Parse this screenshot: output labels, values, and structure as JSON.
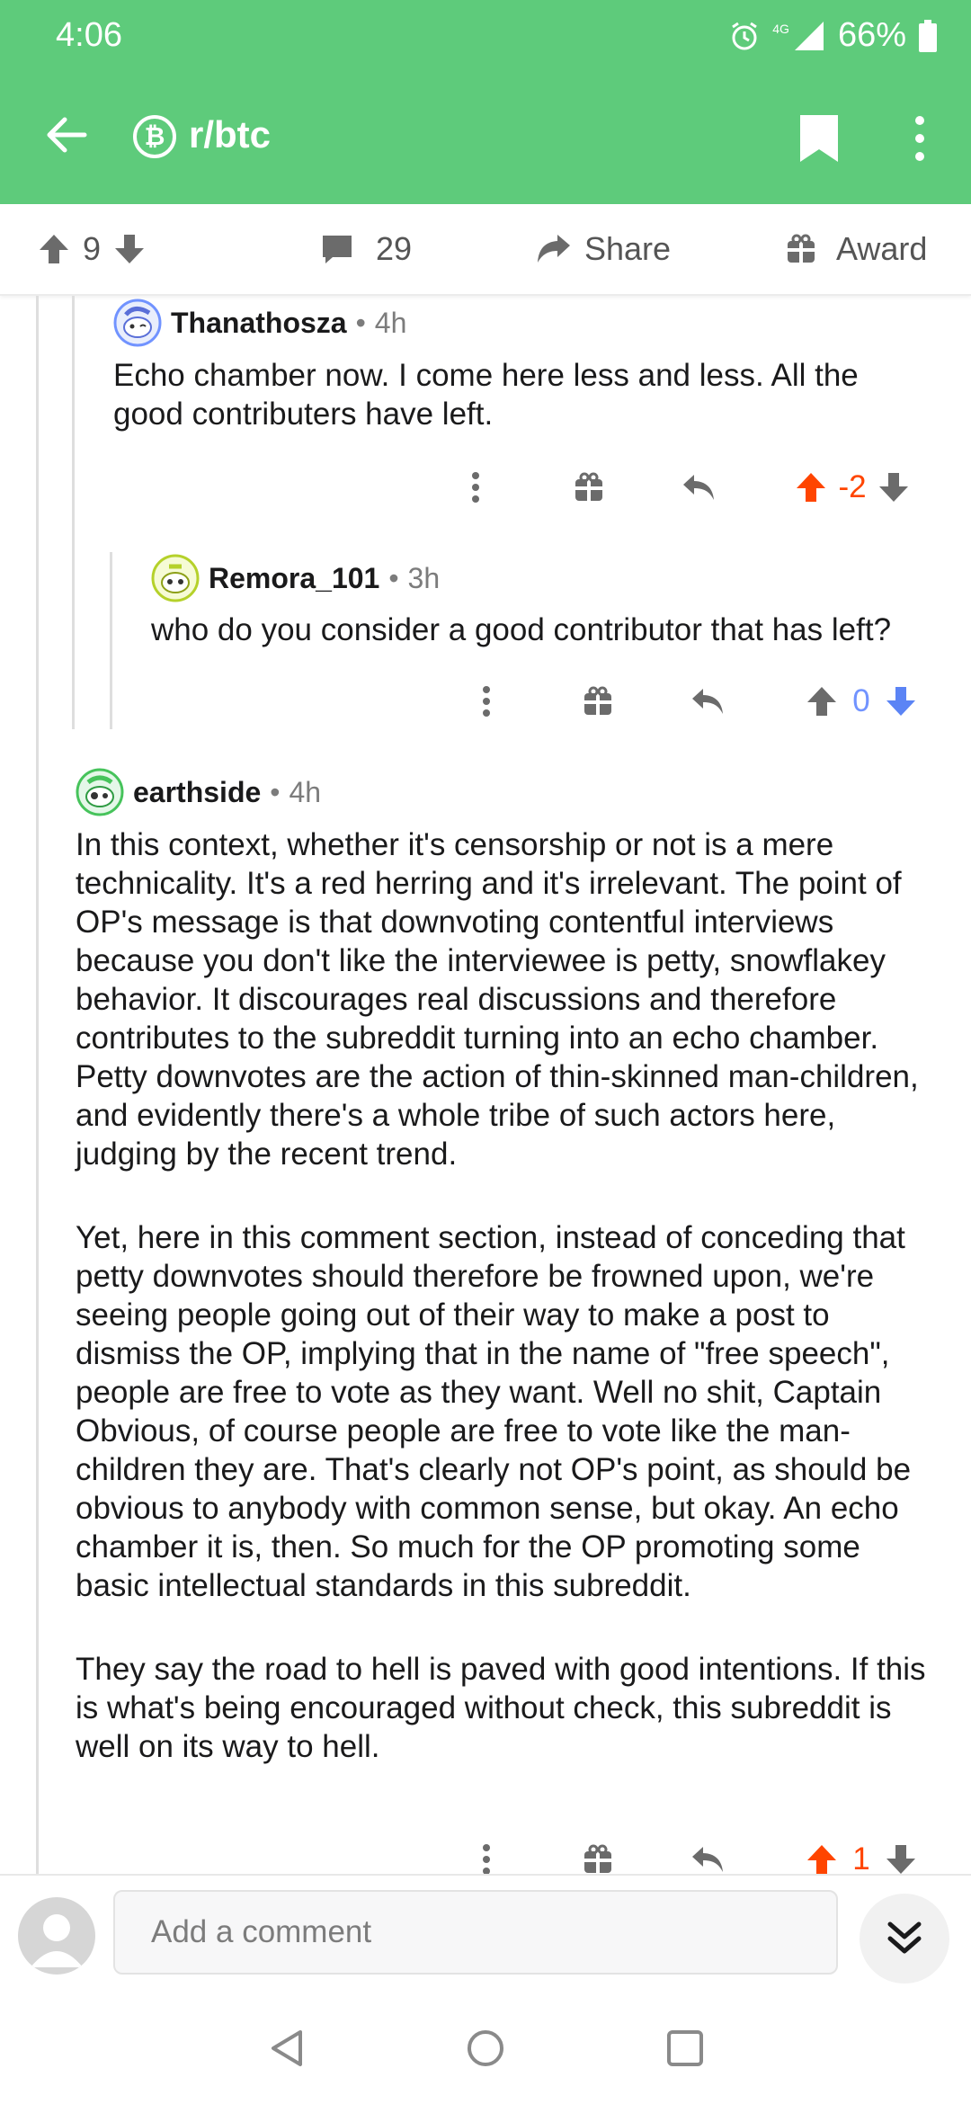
{
  "status_bar": {
    "time": "4:06",
    "network": "4G",
    "battery": "66%"
  },
  "header": {
    "subreddit": "r/btc",
    "subreddit_icon": "bitcoin-icon"
  },
  "action_bar": {
    "upvotes": "9",
    "comments": "29",
    "share_label": "Share",
    "award_label": "Award"
  },
  "comments": [
    {
      "author": "Thanathosza",
      "time": "4h",
      "body": [
        "Echo chamber now. I come here less and less. All the good contributers have left."
      ],
      "score": "-2",
      "vote": "up"
    },
    {
      "author": "Remora_101",
      "time": "3h",
      "body": [
        "who do you consider a good contributor that has left?"
      ],
      "score": "0",
      "vote": "down"
    },
    {
      "author": "earthside",
      "time": "4h",
      "body": [
        "In this context, whether it's censorship or not is a mere technicality. It's a red herring and it's irrelevant. The point of OP's message is that downvoting contentful interviews because you don't like the interviewee is petty, snowflakey behavior. It discourages real discussions and therefore contributes to the subreddit turning into an echo chamber. Petty downvotes are the action of thin-skinned man-children, and evidently there's a whole tribe of such actors here, judging by the recent trend.",
        "Yet, here in this comment section, instead of conceding that petty downvotes should therefore be frowned upon, we're seeing people going out of their way to make a post to dismiss the OP, implying that in the name of \"free speech\", people are free to vote as they want. Well no shit, Captain Obvious, of course people are free to vote like the man-children they are. That's clearly not OP's point, as should be obvious to anybody with common sense, but okay. An echo chamber it is, then. So much for the OP promoting some basic intellectual standards in this subreddit.",
        "They say the road to hell is paved with good intentions. If this is what's being encouraged without check, this subreddit is well on its way to hell."
      ],
      "score": "1",
      "vote": "up"
    }
  ],
  "composer": {
    "placeholder": "Add a comment"
  },
  "colors": {
    "brand_green": "#5ecb7b",
    "upvote": "#ff4500",
    "downvote": "#7193ff",
    "neutral": "#6b6b6b"
  }
}
